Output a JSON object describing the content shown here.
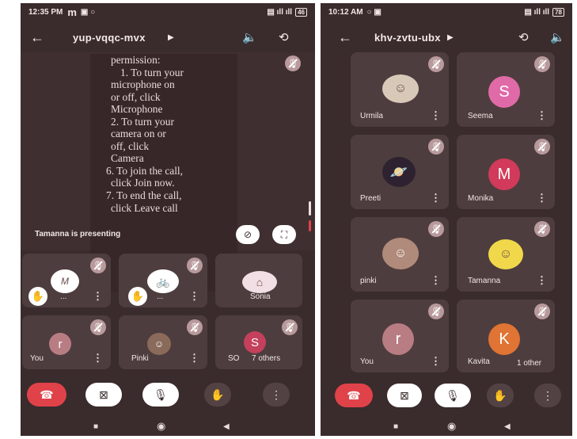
{
  "left_phone": {
    "status": {
      "time": "12:35 PM",
      "extra": "m",
      "battery": "46"
    },
    "meeting_code": "yup-vqqc-mvx",
    "document_lines": [
      "permission:",
      "1. To turn your",
      "microphone on",
      "or off, click",
      "Microphone",
      "2. To turn your",
      "camera on or",
      "off, click",
      "Camera",
      "6. To join the call,",
      "click Join now.",
      "7. To end the call,",
      "click Leave call"
    ],
    "presenting_label": "Tamanna is presenting",
    "tiles": [
      {
        "name": "...",
        "avatar_letter": "",
        "avatar_color": "#ffffff"
      },
      {
        "name": "...",
        "avatar_letter": "",
        "avatar_color": "#ffffff"
      },
      {
        "name": "Sonia",
        "avatar_letter": "",
        "avatar_color": "#f2dfe5"
      },
      {
        "name": "You",
        "avatar_letter": "r",
        "avatar_color": "#b87d83"
      },
      {
        "name": "Pinki",
        "avatar_letter": "",
        "avatar_color": "#8a6a5a"
      },
      {
        "name": "SO",
        "avatar_letter": "S",
        "avatar_color": "#c4405c"
      }
    ],
    "others_label": "7 others"
  },
  "right_phone": {
    "status": {
      "time": "10:12 AM",
      "battery": "78"
    },
    "meeting_code": "khv-zvtu-ubx",
    "tiles": [
      {
        "name": "Urmila",
        "avatar_letter": "",
        "avatar_color": "#d8c8b8"
      },
      {
        "name": "Seema",
        "avatar_letter": "S",
        "avatar_color": "#e06aa8"
      },
      {
        "name": "Preeti",
        "avatar_letter": "",
        "avatar_color": "#2f2230"
      },
      {
        "name": "Monika",
        "avatar_letter": "M",
        "avatar_color": "#d13a5a"
      },
      {
        "name": "pinki",
        "avatar_letter": "",
        "avatar_color": "#b08a7a"
      },
      {
        "name": "Tamanna",
        "avatar_letter": "",
        "avatar_color": "#f0d84a"
      },
      {
        "name": "You",
        "avatar_letter": "r",
        "avatar_color": "#b87d83"
      },
      {
        "name": "Kavita",
        "avatar_letter": "K",
        "avatar_color": "#e07434"
      }
    ],
    "others_label": "1 other"
  },
  "colors": {
    "background": "#3a2b2c",
    "tile": "#4e3d3e",
    "end_call": "#e0424a",
    "mute_badge": "#b99a9c"
  },
  "icons": [
    "back-arrow-icon",
    "chevron-right-icon",
    "speaker-icon",
    "switch-camera-icon",
    "mic-off-icon",
    "hand-raise-icon",
    "more-vert-icon",
    "end-call-icon",
    "camera-off-icon",
    "fullscreen-icon",
    "nav-square-icon",
    "nav-circle-icon",
    "nav-back-icon"
  ]
}
